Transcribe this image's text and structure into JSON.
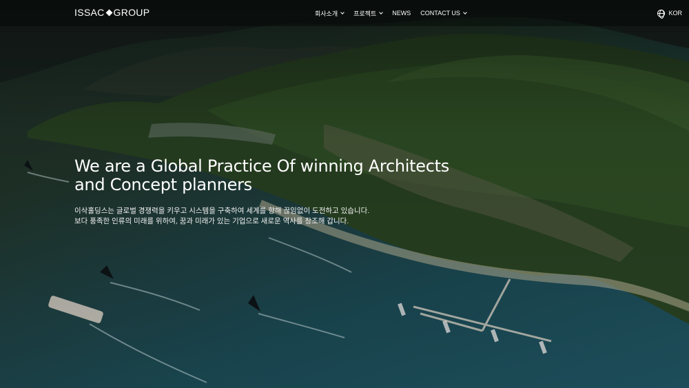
{
  "header": {
    "logo_left": "ISSAC",
    "logo_right": "GROUP",
    "nav": [
      {
        "label": "회사소개",
        "has_dropdown": true
      },
      {
        "label": "프로젝트",
        "has_dropdown": true
      },
      {
        "label": "NEWS",
        "has_dropdown": false
      },
      {
        "label": "CONTACT US",
        "has_dropdown": true
      }
    ],
    "language": "KOR",
    "language_icon": "globe-icon"
  },
  "hero": {
    "headline_line1": "We are a Global Practice Of winning Architects",
    "headline_line2": "and Concept planners",
    "subtext_line1": "이삭홀딩스는 글로벌 경쟁력을 키우고 시스템을 구축하여 세계를 향해 끊임없이 도전하고 있습니다.",
    "subtext_line2": "보다 풍족한 인류의 미래를 위하여, 꿈과 미래가 있는 기업으로 새로운 역사를 창조해 갑니다."
  },
  "colors": {
    "water": "#1c4d58",
    "forest": "#2c4a24",
    "text": "#ffffff"
  }
}
